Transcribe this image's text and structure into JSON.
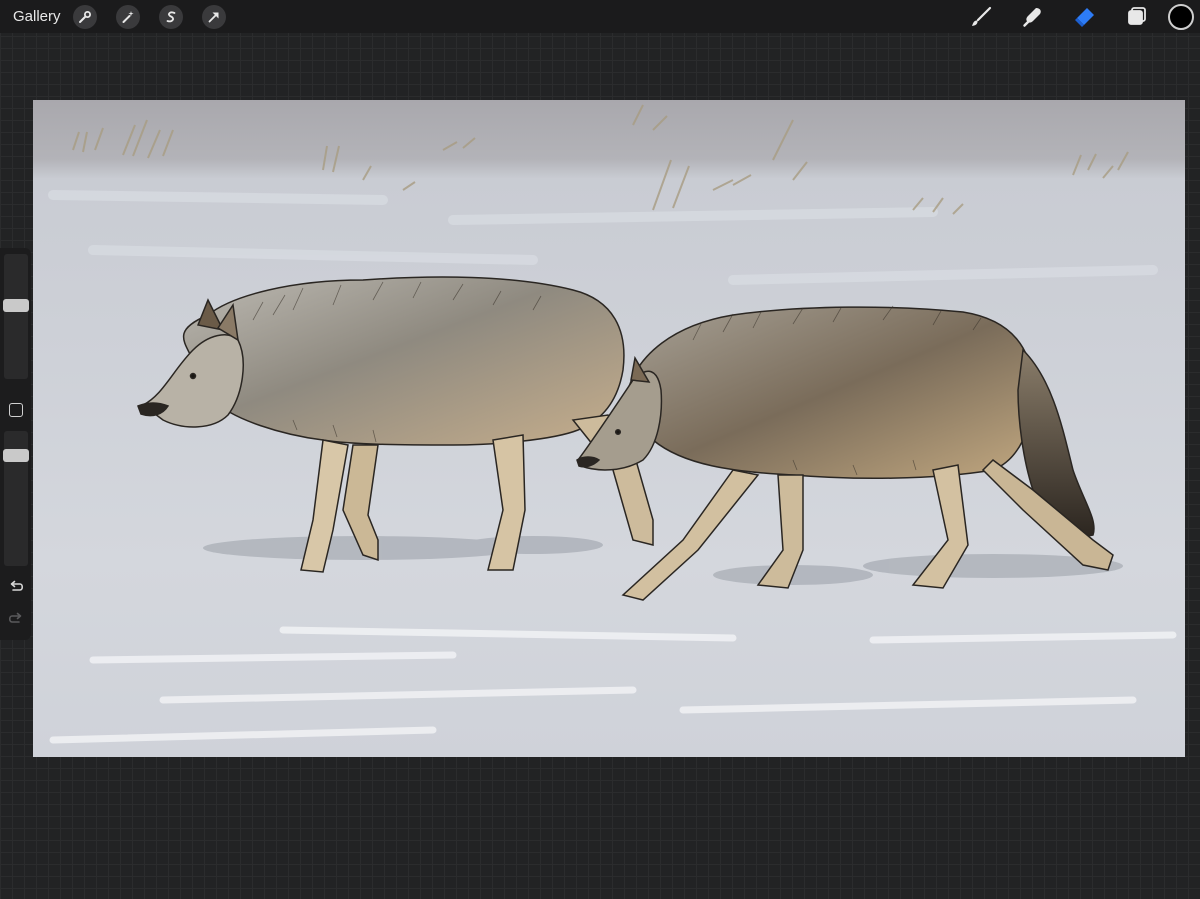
{
  "topbar": {
    "gallery_label": "Gallery",
    "left_tools": [
      {
        "name": "wrench-icon",
        "action": "actions"
      },
      {
        "name": "magic-wand-icon",
        "action": "adjustments"
      },
      {
        "name": "selection-s-icon",
        "action": "selection"
      },
      {
        "name": "arrow-cursor-icon",
        "action": "transform"
      }
    ],
    "right_tools": [
      {
        "name": "brush-icon",
        "active": false
      },
      {
        "name": "smudge-icon",
        "active": false
      },
      {
        "name": "eraser-icon",
        "active": true
      },
      {
        "name": "layers-icon",
        "active": false
      }
    ],
    "current_color": "#000000",
    "accent_color": "#2d7cf6"
  },
  "sidebar": {
    "brush_size_level": 0.6,
    "opacity_level": 0.85
  },
  "canvas": {
    "subject": "wolves-in-snow-painting"
  }
}
